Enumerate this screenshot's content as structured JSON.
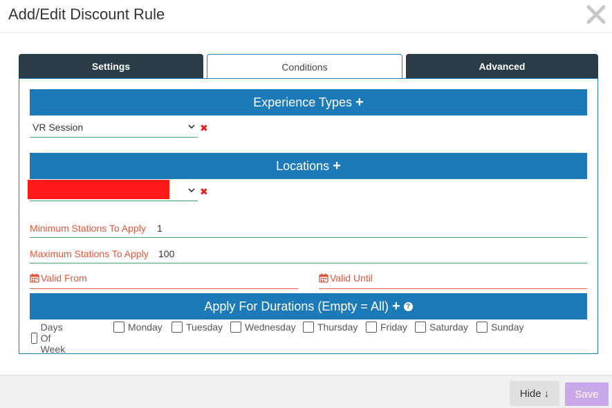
{
  "modal": {
    "title": "Add/Edit Discount Rule",
    "close_icon": "close-icon"
  },
  "tabs": [
    {
      "label": "Settings",
      "active": false
    },
    {
      "label": "Conditions",
      "active": true
    },
    {
      "label": "Advanced",
      "active": false
    }
  ],
  "sections": {
    "experience_types": {
      "title": "Experience Types",
      "plus": "+",
      "selected": "VR Session",
      "remove": "✖"
    },
    "locations": {
      "title": "Locations",
      "plus": "+",
      "selected": "",
      "remove": "✖"
    },
    "durations": {
      "title": "Apply For Durations (Empty = All)",
      "plus": "+",
      "help": "?"
    }
  },
  "fields": {
    "min_stations": {
      "label": "Minimum Stations To Apply",
      "value": "1"
    },
    "max_stations": {
      "label": "Maximum Stations To Apply",
      "value": "100"
    },
    "valid_from": {
      "label": "Valid From"
    },
    "valid_until": {
      "label": "Valid Until"
    }
  },
  "days": [
    "Days Of Week",
    "Monday",
    "Tuesday",
    "Wednesday",
    "Thursday",
    "Friday",
    "Saturday",
    "Sunday"
  ],
  "footer": {
    "hide_label": "Hide ↓",
    "save_label": "Save"
  },
  "colors": {
    "tab_dark": "#2a3c47",
    "section_blue": "#1c7ab8",
    "label_red": "#e2583e",
    "underline_green": "#3aa76d",
    "save_purple": "#c9a8ea"
  }
}
